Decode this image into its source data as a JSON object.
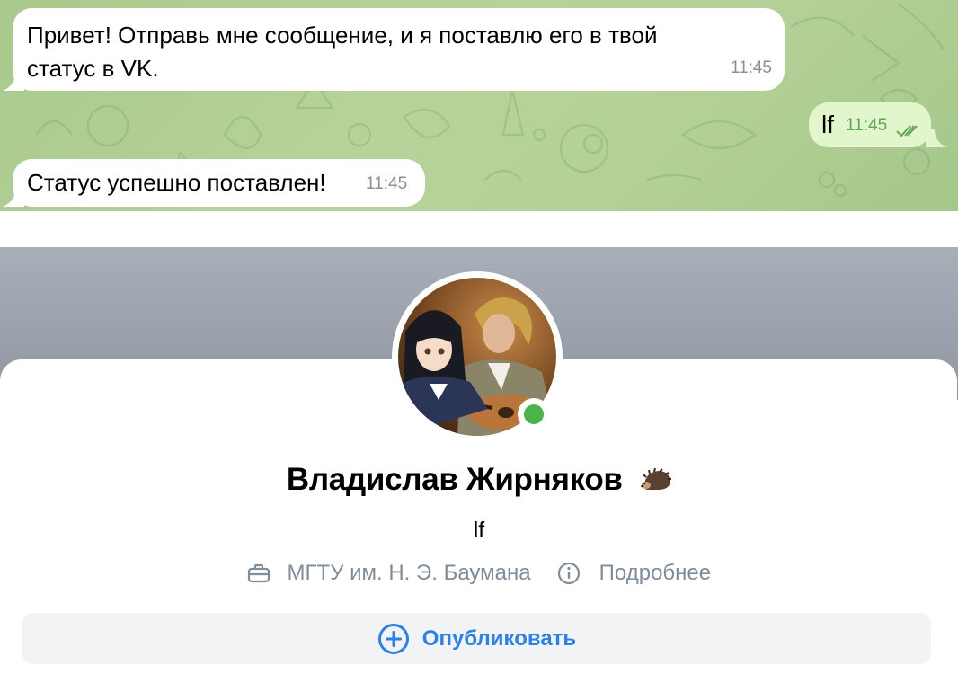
{
  "chat": {
    "messages": [
      {
        "direction": "in",
        "text_line1": "Привет! Отправь мне сообщение, и я поставлю его в твой",
        "text_line2": "статус в VK.",
        "time": "11:45"
      },
      {
        "direction": "out",
        "text": "lf",
        "time": "11:45",
        "status_icon": "double-check-icon"
      },
      {
        "direction": "in",
        "text": "Статус успешно поставлен!",
        "time": "11:45"
      }
    ]
  },
  "profile": {
    "name": "Владислав Жирняков",
    "emoji_icon": "hedgehog-icon",
    "status": "lf",
    "online": true,
    "education": "МГТУ им. Н. Э. Баумана",
    "details_link": "Подробнее",
    "publish_button": "Опубликовать"
  },
  "colors": {
    "accent": "#2d81e0",
    "online": "#4bb34b",
    "chat_background": "#b3d096",
    "outgoing_bubble": "#e1f6cd",
    "secondary_text": "#818c99"
  }
}
